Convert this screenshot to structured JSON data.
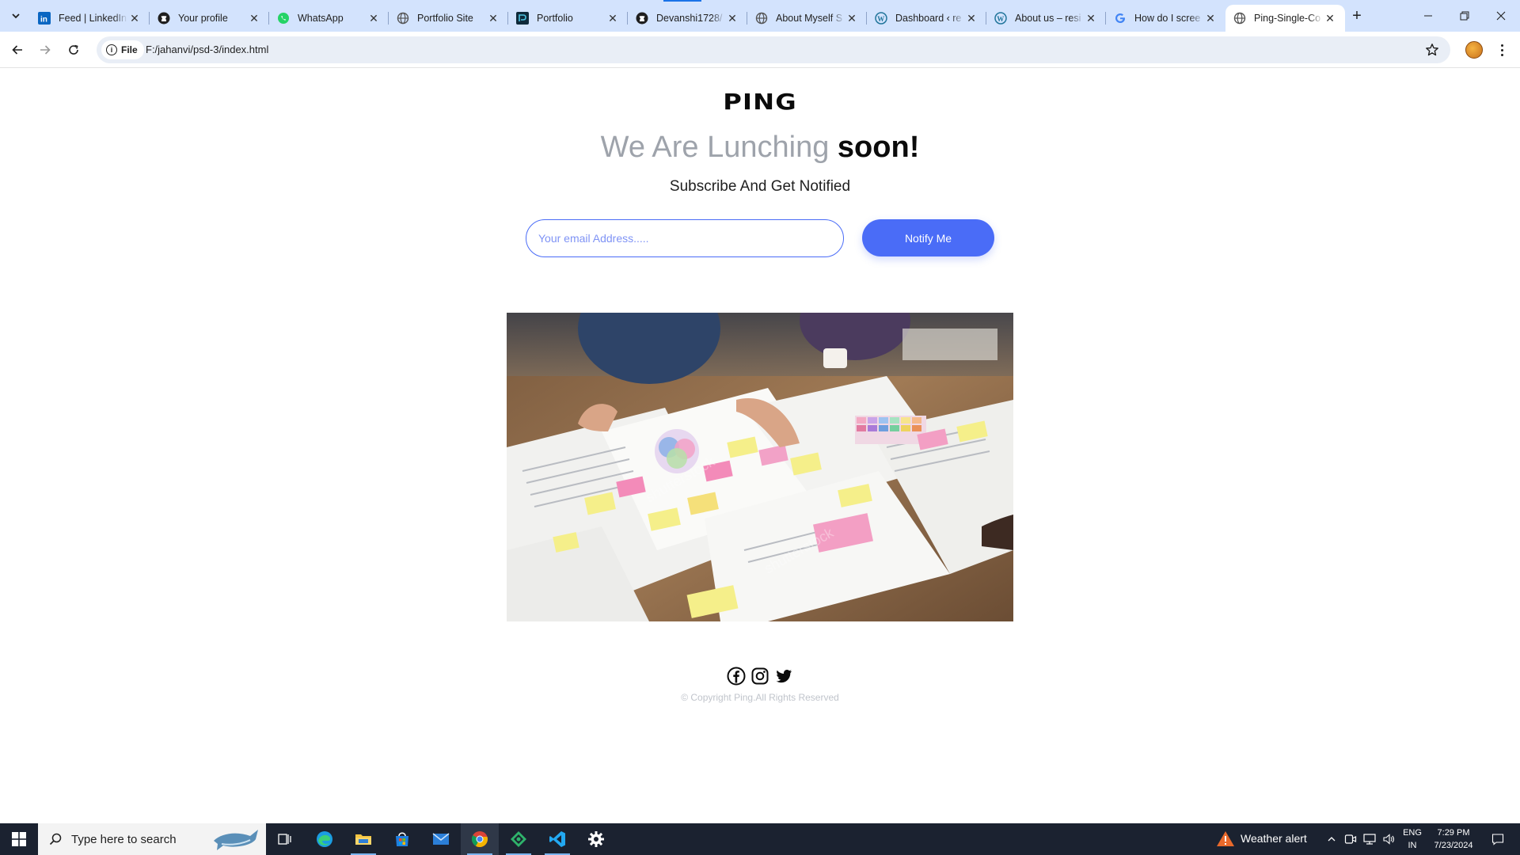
{
  "browser": {
    "tabs": [
      {
        "title": "Feed | LinkedIn",
        "icon": "linkedin-icon"
      },
      {
        "title": "Your profile",
        "icon": "github-icon"
      },
      {
        "title": "WhatsApp",
        "icon": "whatsapp-icon"
      },
      {
        "title": "Portfolio Site",
        "icon": "globe-icon"
      },
      {
        "title": "Portfolio",
        "icon": "portfolio-icon"
      },
      {
        "title": "Devanshi1728/",
        "icon": "github-icon"
      },
      {
        "title": "About Myself S",
        "icon": "globe-icon"
      },
      {
        "title": "Dashboard ‹ re",
        "icon": "wordpress-icon"
      },
      {
        "title": "About us – resi",
        "icon": "wordpress-icon"
      },
      {
        "title": "How do I scree",
        "icon": "google-icon"
      },
      {
        "title": "Ping-Single-Co",
        "icon": "globe-icon",
        "active": true
      }
    ],
    "chip_label": "File",
    "url": "F:/jahanvi/psd-3/index.html"
  },
  "page": {
    "logo": "PING",
    "headline_light": "We Are Lunching",
    "headline_bold": "soon!",
    "subline": "Subscribe And Get Notified",
    "email_placeholder": "Your email Address.....",
    "notify_label": "Notify Me",
    "copyright": "© Copyright Ping.All Rights Reserved",
    "social": [
      "facebook-icon",
      "instagram-icon",
      "twitter-icon"
    ],
    "colors": {
      "accent": "#4a6cf7",
      "headline_light": "#9ea3ab",
      "text_dark": "#0b0b0b"
    }
  },
  "taskbar": {
    "search_placeholder": "Type here to search",
    "weather": "Weather alert",
    "lang_top": "ENG",
    "lang_bottom": "IN",
    "time": "7:29 PM",
    "date": "7/23/2024"
  }
}
